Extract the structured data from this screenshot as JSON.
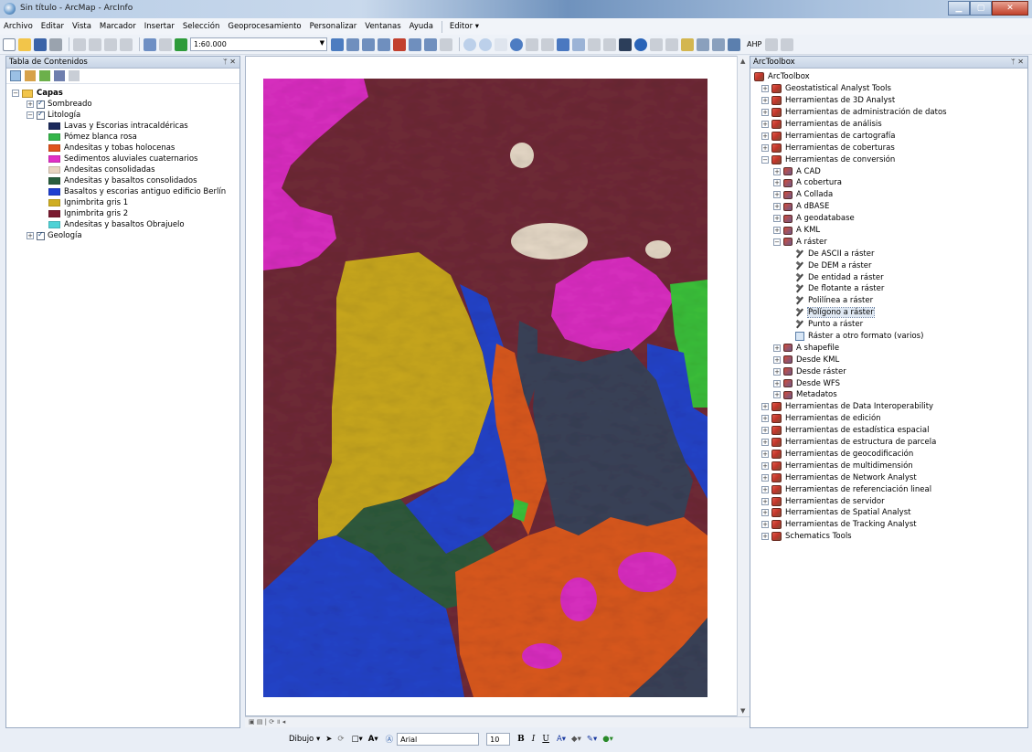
{
  "window": {
    "title": "Sin título - ArcMap - ArcInfo"
  },
  "menu": [
    "Archivo",
    "Editar",
    "Vista",
    "Marcador",
    "Insertar",
    "Selección",
    "Geoprocesamiento",
    "Personalizar",
    "Ventanas",
    "Ayuda"
  ],
  "editor_menu": "Editor ▾",
  "toolbar": {
    "scale": "1:60.000",
    "ahp": "AHP"
  },
  "toc": {
    "title": "Tabla de Contenidos",
    "root": "Capas",
    "layers": [
      {
        "name": "Sombreado",
        "expanded": false
      },
      {
        "name": "Litología",
        "expanded": true
      },
      {
        "name": "Geología",
        "expanded": false
      }
    ],
    "legend": [
      {
        "label": "Lavas y Escorias intracaldéricas",
        "color": "#1c2a5c"
      },
      {
        "label": "Pómez blanca rosa",
        "color": "#35b64a"
      },
      {
        "label": "Andesitas y tobas holocenas",
        "color": "#e0521c"
      },
      {
        "label": "Sedimentos aluviales cuaternarios",
        "color": "#e12fc6"
      },
      {
        "label": "Andesitas consolidadas",
        "color": "#e8d4c0"
      },
      {
        "label": "Andesitas y basaltos consolidados",
        "color": "#285e3d"
      },
      {
        "label": "Basaltos y escorias antiguo edificio Berlín",
        "color": "#1f3fd0"
      },
      {
        "label": "Ignimbrita gris 1",
        "color": "#cfae22"
      },
      {
        "label": "Ignimbrita gris 2",
        "color": "#7a1a30"
      },
      {
        "label": "Andesitas y basaltos Obrajuelo",
        "color": "#4fd2d6"
      }
    ]
  },
  "map": {
    "colors": {
      "ignimbrita2": "#6f2a36",
      "aluvial": "#d92ec0",
      "ignimbrita1": "#c8a71e",
      "basaltos_berlin": "#2443c8",
      "andesitas_basaltos": "#2f5a3c",
      "andesitas_tobas": "#d9581f",
      "lavas": "#3a4258",
      "pomez": "#3bbf3a",
      "andesitas_cons": "#e5d8c6"
    }
  },
  "drawbar": {
    "dibujo": "Dibujo ▾",
    "font": "Arial",
    "size": "10",
    "bold": "B",
    "italic": "I",
    "underline": "U"
  },
  "arctoolbox": {
    "title": "ArcToolbox",
    "root": "ArcToolbox",
    "items": [
      {
        "label": "Geostatistical Analyst Tools",
        "level": 0,
        "kind": "box",
        "toggle": "+"
      },
      {
        "label": "Herramientas de 3D Analyst",
        "level": 0,
        "kind": "box",
        "toggle": "+"
      },
      {
        "label": "Herramientas de administración de datos",
        "level": 0,
        "kind": "box",
        "toggle": "+"
      },
      {
        "label": "Herramientas de análisis",
        "level": 0,
        "kind": "box",
        "toggle": "+"
      },
      {
        "label": "Herramientas de cartografía",
        "level": 0,
        "kind": "box",
        "toggle": "+"
      },
      {
        "label": "Herramientas de coberturas",
        "level": 0,
        "kind": "box",
        "toggle": "+"
      },
      {
        "label": "Herramientas de conversión",
        "level": 0,
        "kind": "box",
        "toggle": "−"
      },
      {
        "label": "A CAD",
        "level": 1,
        "kind": "sub",
        "toggle": "+"
      },
      {
        "label": "A cobertura",
        "level": 1,
        "kind": "sub",
        "toggle": "+"
      },
      {
        "label": "A Collada",
        "level": 1,
        "kind": "sub",
        "toggle": "+"
      },
      {
        "label": "A dBASE",
        "level": 1,
        "kind": "sub",
        "toggle": "+"
      },
      {
        "label": "A geodatabase",
        "level": 1,
        "kind": "sub",
        "toggle": "+"
      },
      {
        "label": "A KML",
        "level": 1,
        "kind": "sub",
        "toggle": "+"
      },
      {
        "label": "A ráster",
        "level": 1,
        "kind": "sub",
        "toggle": "−"
      },
      {
        "label": "De ASCII a ráster",
        "level": 2,
        "kind": "tool"
      },
      {
        "label": "De DEM a ráster",
        "level": 2,
        "kind": "tool"
      },
      {
        "label": "De entidad a ráster",
        "level": 2,
        "kind": "tool"
      },
      {
        "label": "De flotante a ráster",
        "level": 2,
        "kind": "tool"
      },
      {
        "label": "Polilínea a ráster",
        "level": 2,
        "kind": "tool"
      },
      {
        "label": "Polígono a ráster",
        "level": 2,
        "kind": "tool",
        "selected": true
      },
      {
        "label": "Punto a ráster",
        "level": 2,
        "kind": "tool"
      },
      {
        "label": "Ráster a otro formato (varios)",
        "level": 2,
        "kind": "script"
      },
      {
        "label": "A shapefile",
        "level": 1,
        "kind": "sub",
        "toggle": "+"
      },
      {
        "label": "Desde KML",
        "level": 1,
        "kind": "sub",
        "toggle": "+"
      },
      {
        "label": "Desde ráster",
        "level": 1,
        "kind": "sub",
        "toggle": "+"
      },
      {
        "label": "Desde WFS",
        "level": 1,
        "kind": "sub",
        "toggle": "+"
      },
      {
        "label": "Metadatos",
        "level": 1,
        "kind": "sub",
        "toggle": "+"
      },
      {
        "label": "Herramientas de Data Interoperability",
        "level": 0,
        "kind": "box",
        "toggle": "+"
      },
      {
        "label": "Herramientas de edición",
        "level": 0,
        "kind": "box",
        "toggle": "+"
      },
      {
        "label": "Herramientas de estadística espacial",
        "level": 0,
        "kind": "box",
        "toggle": "+"
      },
      {
        "label": "Herramientas de estructura de parcela",
        "level": 0,
        "kind": "box",
        "toggle": "+"
      },
      {
        "label": "Herramientas de geocodificación",
        "level": 0,
        "kind": "box",
        "toggle": "+"
      },
      {
        "label": "Herramientas de multidimensión",
        "level": 0,
        "kind": "box",
        "toggle": "+"
      },
      {
        "label": "Herramientas de Network Analyst",
        "level": 0,
        "kind": "box",
        "toggle": "+"
      },
      {
        "label": "Herramientas de referenciación lineal",
        "level": 0,
        "kind": "box",
        "toggle": "+"
      },
      {
        "label": "Herramientas de servidor",
        "level": 0,
        "kind": "box",
        "toggle": "+"
      },
      {
        "label": "Herramientas de Spatial Analyst",
        "level": 0,
        "kind": "box",
        "toggle": "+"
      },
      {
        "label": "Herramientas de Tracking Analyst",
        "level": 0,
        "kind": "box",
        "toggle": "+"
      },
      {
        "label": "Schematics Tools",
        "level": 0,
        "kind": "box",
        "toggle": "+"
      }
    ]
  }
}
